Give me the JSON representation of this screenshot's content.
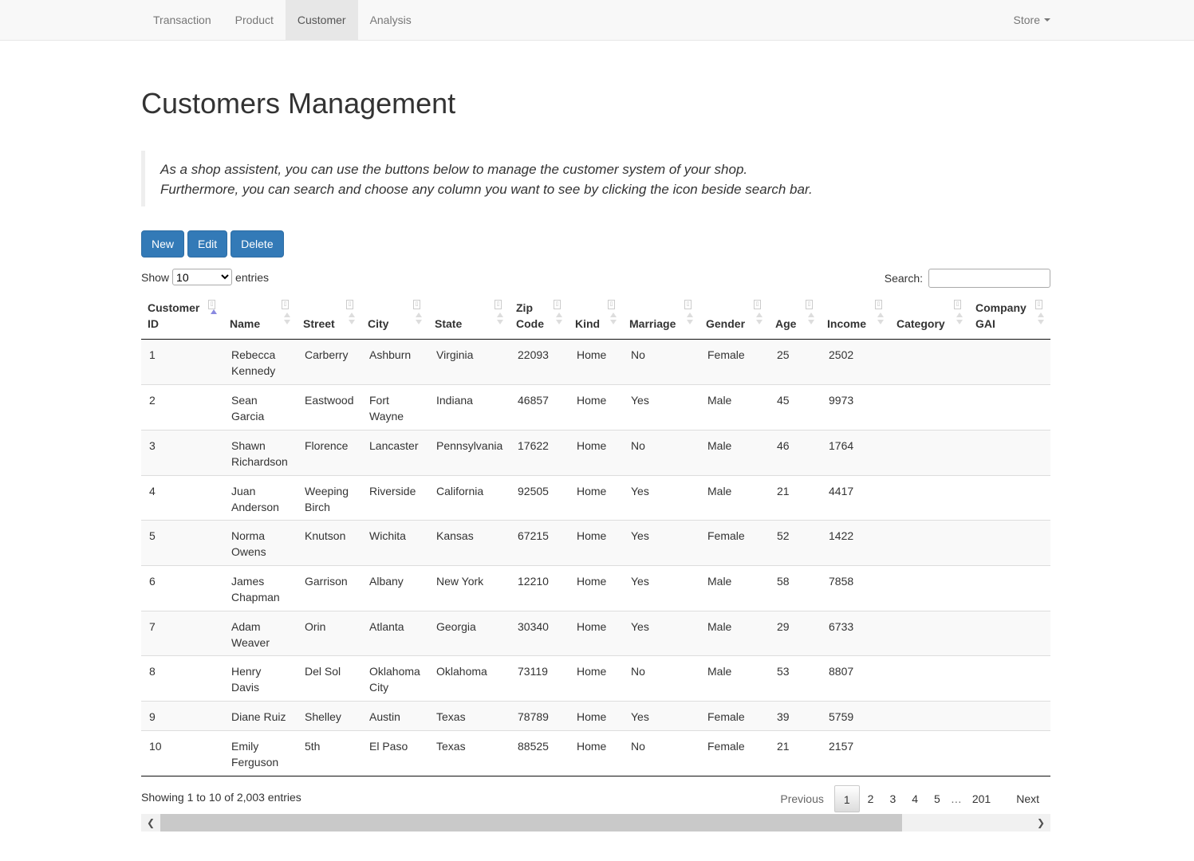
{
  "nav": {
    "items": [
      "Transaction",
      "Product",
      "Customer",
      "Analysis"
    ],
    "active": "Customer",
    "store": "Store"
  },
  "page": {
    "title": "Customers Management",
    "intro_line1": "As a shop assistent, you can use the buttons below to manage the customer system of your shop.",
    "intro_line2": "Furthermore, you can search and choose any column you want to see by clicking the icon beside search bar."
  },
  "toolbar": {
    "new_label": "New",
    "edit_label": "Edit",
    "delete_label": "Delete"
  },
  "length": {
    "show_label": "Show",
    "value": "10",
    "entries_label": "entries"
  },
  "search": {
    "label": "Search:",
    "value": ""
  },
  "table": {
    "columns": [
      [
        "Customer",
        "ID"
      ],
      [
        "",
        "Name"
      ],
      [
        "",
        "Street"
      ],
      [
        "",
        "City"
      ],
      [
        "",
        "State"
      ],
      [
        "Zip",
        "Code"
      ],
      [
        "",
        "Kind"
      ],
      [
        "",
        "Marriage"
      ],
      [
        "",
        "Gender"
      ],
      [
        "",
        "Age"
      ],
      [
        "",
        "Income"
      ],
      [
        "",
        "Category"
      ],
      [
        "Company",
        "GAI"
      ]
    ],
    "rows": [
      [
        [
          "1"
        ],
        [
          "Rebecca",
          "Kennedy"
        ],
        [
          "Carberry"
        ],
        [
          "Ashburn"
        ],
        [
          "Virginia"
        ],
        [
          "22093"
        ],
        [
          "Home"
        ],
        [
          "No"
        ],
        [
          "Female"
        ],
        [
          "25"
        ],
        [
          "2502"
        ],
        [
          ""
        ],
        [
          ""
        ]
      ],
      [
        [
          "2"
        ],
        [
          "Sean",
          "Garcia"
        ],
        [
          "Eastwood"
        ],
        [
          "Fort",
          "Wayne"
        ],
        [
          "Indiana"
        ],
        [
          "46857"
        ],
        [
          "Home"
        ],
        [
          "Yes"
        ],
        [
          "Male"
        ],
        [
          "45"
        ],
        [
          "9973"
        ],
        [
          ""
        ],
        [
          ""
        ]
      ],
      [
        [
          "3"
        ],
        [
          "Shawn",
          "Richardson"
        ],
        [
          "Florence"
        ],
        [
          "Lancaster"
        ],
        [
          "Pennsylvania"
        ],
        [
          "17622"
        ],
        [
          "Home"
        ],
        [
          "No"
        ],
        [
          "Male"
        ],
        [
          "46"
        ],
        [
          "1764"
        ],
        [
          ""
        ],
        [
          ""
        ]
      ],
      [
        [
          "4"
        ],
        [
          "Juan",
          "Anderson"
        ],
        [
          "Weeping",
          "Birch"
        ],
        [
          "Riverside"
        ],
        [
          "California"
        ],
        [
          "92505"
        ],
        [
          "Home"
        ],
        [
          "Yes"
        ],
        [
          "Male"
        ],
        [
          "21"
        ],
        [
          "4417"
        ],
        [
          ""
        ],
        [
          ""
        ]
      ],
      [
        [
          "5"
        ],
        [
          "Norma",
          "Owens"
        ],
        [
          "Knutson"
        ],
        [
          "Wichita"
        ],
        [
          "Kansas"
        ],
        [
          "67215"
        ],
        [
          "Home"
        ],
        [
          "Yes"
        ],
        [
          "Female"
        ],
        [
          "52"
        ],
        [
          "1422"
        ],
        [
          ""
        ],
        [
          ""
        ]
      ],
      [
        [
          "6"
        ],
        [
          "James",
          "Chapman"
        ],
        [
          "Garrison"
        ],
        [
          "Albany"
        ],
        [
          "New York"
        ],
        [
          "12210"
        ],
        [
          "Home"
        ],
        [
          "Yes"
        ],
        [
          "Male"
        ],
        [
          "58"
        ],
        [
          "7858"
        ],
        [
          ""
        ],
        [
          ""
        ]
      ],
      [
        [
          "7"
        ],
        [
          "Adam",
          "Weaver"
        ],
        [
          "Orin"
        ],
        [
          "Atlanta"
        ],
        [
          "Georgia"
        ],
        [
          "30340"
        ],
        [
          "Home"
        ],
        [
          "Yes"
        ],
        [
          "Male"
        ],
        [
          "29"
        ],
        [
          "6733"
        ],
        [
          ""
        ],
        [
          ""
        ]
      ],
      [
        [
          "8"
        ],
        [
          "Henry",
          "Davis"
        ],
        [
          "Del Sol"
        ],
        [
          "Oklahoma",
          "City"
        ],
        [
          "Oklahoma"
        ],
        [
          "73119"
        ],
        [
          "Home"
        ],
        [
          "No"
        ],
        [
          "Male"
        ],
        [
          "53"
        ],
        [
          "8807"
        ],
        [
          ""
        ],
        [
          ""
        ]
      ],
      [
        [
          "9"
        ],
        [
          "Diane Ruiz"
        ],
        [
          "Shelley"
        ],
        [
          "Austin"
        ],
        [
          "Texas"
        ],
        [
          "78789"
        ],
        [
          "Home"
        ],
        [
          "Yes"
        ],
        [
          "Female"
        ],
        [
          "39"
        ],
        [
          "5759"
        ],
        [
          ""
        ],
        [
          ""
        ]
      ],
      [
        [
          "10"
        ],
        [
          "Emily",
          "Ferguson"
        ],
        [
          "5th"
        ],
        [
          "El Paso"
        ],
        [
          "Texas"
        ],
        [
          "88525"
        ],
        [
          "Home"
        ],
        [
          "No"
        ],
        [
          "Female"
        ],
        [
          "21"
        ],
        [
          "2157"
        ],
        [
          ""
        ],
        [
          ""
        ]
      ]
    ]
  },
  "footer": {
    "info": "Showing 1 to 10 of 2,003 entries",
    "previous": "Previous",
    "pages": [
      "1",
      "2",
      "3",
      "4",
      "5"
    ],
    "ellipsis": "…",
    "last_page": "201",
    "next": "Next",
    "current_page": "1"
  }
}
